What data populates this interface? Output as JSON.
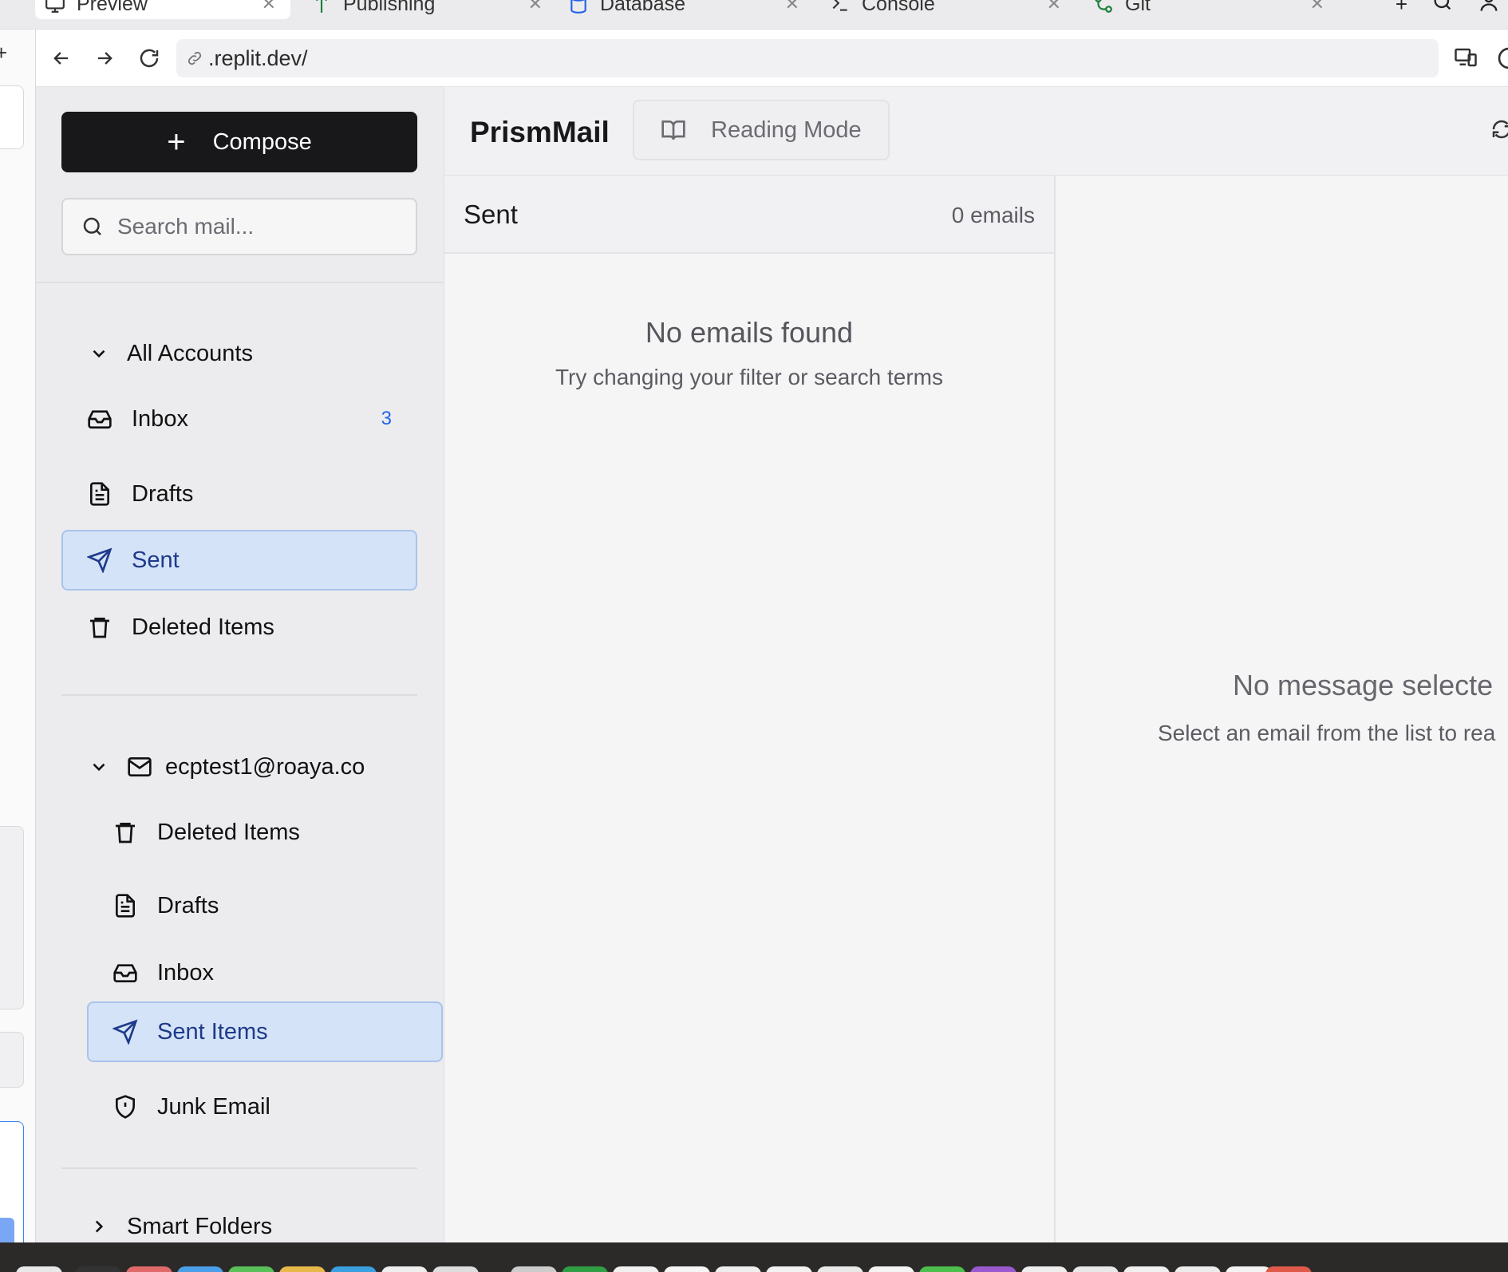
{
  "browser_tabs": [
    {
      "label": "Preview",
      "icon": "monitor-icon",
      "active": true
    },
    {
      "label": "Publishing",
      "icon": "rocket-icon",
      "active": false
    },
    {
      "label": "Database",
      "icon": "database-icon",
      "active": false
    },
    {
      "label": "Console",
      "icon": "terminal-icon",
      "active": false
    },
    {
      "label": "Git",
      "icon": "git-icon",
      "active": false
    }
  ],
  "address_bar": {
    "url": ".replit.dev/",
    "icons": [
      "back-arrow-icon",
      "forward-arrow-icon",
      "reload-icon",
      "link-icon",
      "devices-icon",
      "palette-icon"
    ]
  },
  "sidebar": {
    "compose_label": "Compose",
    "search_placeholder": "Search mail...",
    "all_accounts": {
      "label": "All Accounts",
      "folders": [
        {
          "label": "Inbox",
          "icon": "inbox-icon",
          "count": "3"
        },
        {
          "label": "Drafts",
          "icon": "file-text-icon"
        },
        {
          "label": "Sent",
          "icon": "send-icon",
          "selected": true
        },
        {
          "label": "Deleted Items",
          "icon": "trash-icon"
        }
      ]
    },
    "account": {
      "label": "ecptest1@roaya.co",
      "folders": [
        {
          "label": "Deleted Items",
          "icon": "trash-icon"
        },
        {
          "label": "Drafts",
          "icon": "file-text-icon"
        },
        {
          "label": "Inbox",
          "icon": "inbox-icon"
        },
        {
          "label": "Sent Items",
          "icon": "send-icon",
          "selected": true
        },
        {
          "label": "Junk Email",
          "icon": "shield-alert-icon"
        }
      ]
    },
    "smart_folders_label": "Smart Folders"
  },
  "header": {
    "brand": "PrismMail",
    "reading_mode_label": "Reading Mode"
  },
  "email_list": {
    "title": "Sent",
    "count": "0 emails",
    "empty_title": "No emails found",
    "empty_subtitle": "Try changing your filter or search terms"
  },
  "reading_pane": {
    "empty_title": "No message selecte",
    "empty_subtitle": "Select an email from the list to rea"
  },
  "colors": {
    "compose_bg": "#18181b",
    "selected_bg": "#d5e3f8",
    "selected_text": "#1e3a8a",
    "count_badge": "#2563eb"
  }
}
